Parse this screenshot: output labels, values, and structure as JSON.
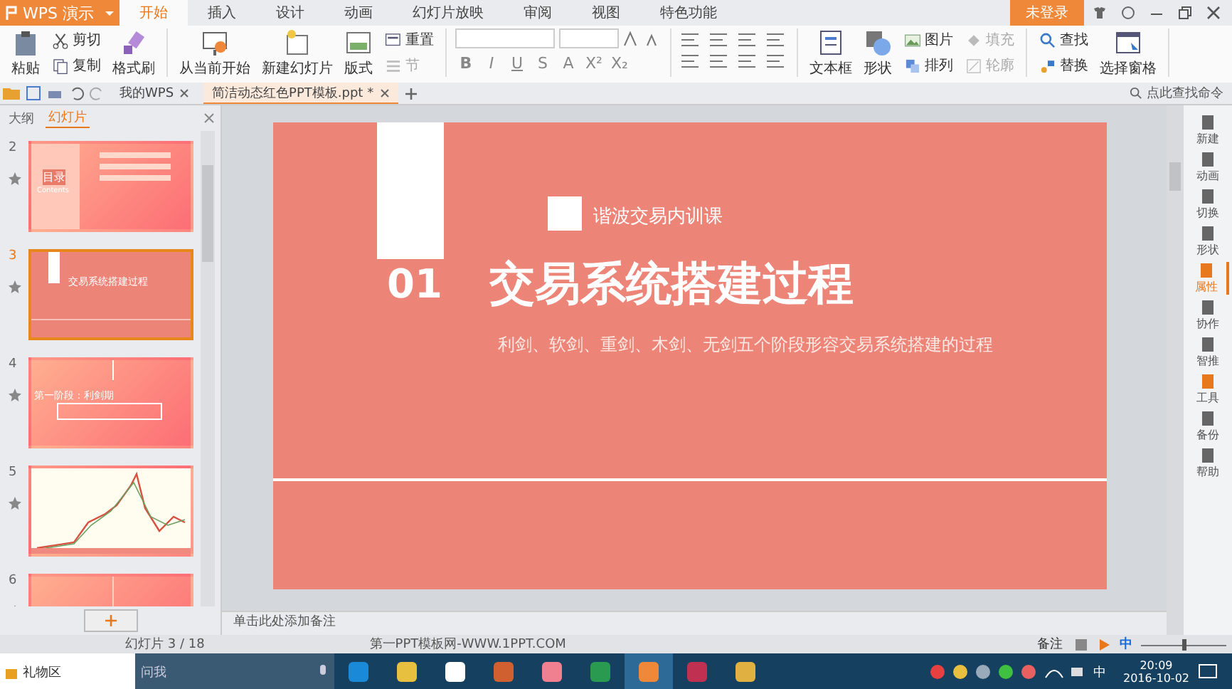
{
  "app_menu": {
    "label": "WPS 演示"
  },
  "ribbon_tabs": [
    {
      "label": "开始",
      "selected": true
    },
    {
      "label": "插入",
      "selected": false
    },
    {
      "label": "设计",
      "selected": false
    },
    {
      "label": "动画",
      "selected": false
    },
    {
      "label": "幻灯片放映",
      "selected": false
    },
    {
      "label": "审阅",
      "selected": false
    },
    {
      "label": "视图",
      "selected": false
    },
    {
      "label": "特色功能",
      "selected": false
    }
  ],
  "account": {
    "label": "未登录"
  },
  "ribbon": {
    "groups": [
      {
        "items": [
          {
            "label": "粘贴",
            "kind": "large",
            "disabled": false
          },
          {
            "label": "剪切",
            "kind": "small",
            "disabled": false
          },
          {
            "label": "复制",
            "kind": "small",
            "disabled": false
          },
          {
            "label": "格式刷",
            "kind": "large",
            "disabled": false
          }
        ]
      },
      {
        "items": [
          {
            "label": "从当前开始",
            "kind": "large",
            "disabled": false
          },
          {
            "label": "新建幻灯片",
            "kind": "large",
            "disabled": false
          },
          {
            "label": "版式",
            "kind": "large",
            "disabled": false
          },
          {
            "label": "重置",
            "kind": "small",
            "disabled": false
          },
          {
            "label": "节",
            "kind": "small",
            "disabled": true
          }
        ]
      },
      {
        "kind": "font",
        "format_buttons": [
          "B",
          "I",
          "U",
          "S",
          "A",
          "X²",
          "X₂"
        ]
      },
      {
        "kind": "paragraph"
      },
      {
        "items": [
          {
            "label": "文本框",
            "kind": "large",
            "disabled": false
          },
          {
            "label": "形状",
            "kind": "large",
            "disabled": false
          },
          {
            "label": "图片",
            "kind": "small",
            "disabled": false
          },
          {
            "label": "排列",
            "kind": "small",
            "disabled": false
          },
          {
            "label": "填充",
            "kind": "small",
            "disabled": true
          },
          {
            "label": "轮廓",
            "kind": "small",
            "disabled": true
          }
        ]
      },
      {
        "items": [
          {
            "label": "查找",
            "kind": "small",
            "disabled": false
          },
          {
            "label": "替换",
            "kind": "small",
            "disabled": false
          },
          {
            "label": "选择窗格",
            "kind": "large",
            "disabled": false
          }
        ]
      }
    ]
  },
  "document_tabs": [
    {
      "label": "我的WPS",
      "selected": false
    },
    {
      "label": "简洁动态红色PPT模板.ppt *",
      "selected": true
    }
  ],
  "command_search": {
    "placeholder": "点此查找命令"
  },
  "panel_tabs": [
    {
      "label": "大纲",
      "selected": false
    },
    {
      "label": "幻灯片",
      "selected": true
    }
  ],
  "thumbnails": [
    {
      "number": "2",
      "kind": "contents",
      "selected": false,
      "texts": [
        "目录",
        "Contents"
      ]
    },
    {
      "number": "3",
      "kind": "title",
      "selected": true,
      "texts": [
        "交易系统搭建过程"
      ]
    },
    {
      "number": "4",
      "kind": "section",
      "selected": false,
      "texts": [
        "第一阶段：利剑期"
      ]
    },
    {
      "number": "5",
      "kind": "chart",
      "selected": false
    },
    {
      "number": "6",
      "kind": "blank",
      "selected": false
    }
  ],
  "slide": {
    "number": "01",
    "tag": "谐波交易内训课",
    "title": "交易系统搭建过程",
    "subtitle": "利剑、软剑、重剑、木剑、无剑五个阶段形容交易系统搭建的过程"
  },
  "notes": {
    "placeholder": "单击此处添加备注"
  },
  "side_tools": [
    {
      "label": "新建",
      "selected": false
    },
    {
      "label": "动画",
      "selected": false
    },
    {
      "label": "切换",
      "selected": false
    },
    {
      "label": "形状",
      "selected": false
    },
    {
      "label": "属性",
      "selected": true
    },
    {
      "label": "协作",
      "selected": false
    },
    {
      "label": "智推",
      "selected": false
    },
    {
      "label": "工具",
      "selected": false
    },
    {
      "label": "备份",
      "selected": false
    },
    {
      "label": "帮助",
      "selected": false
    }
  ],
  "status_bar": {
    "slide_count": "幻灯片 3 / 18",
    "template": "第一PPT模板网-WWW.1PPT.COM",
    "notes_button": "备注",
    "zoom": {
      "level": 0.5
    }
  },
  "taskbar": {
    "gift": "礼物区",
    "search": "问我",
    "ime": "中",
    "tray_ime": "中",
    "time": "20:09",
    "date": "2016-10-02"
  }
}
